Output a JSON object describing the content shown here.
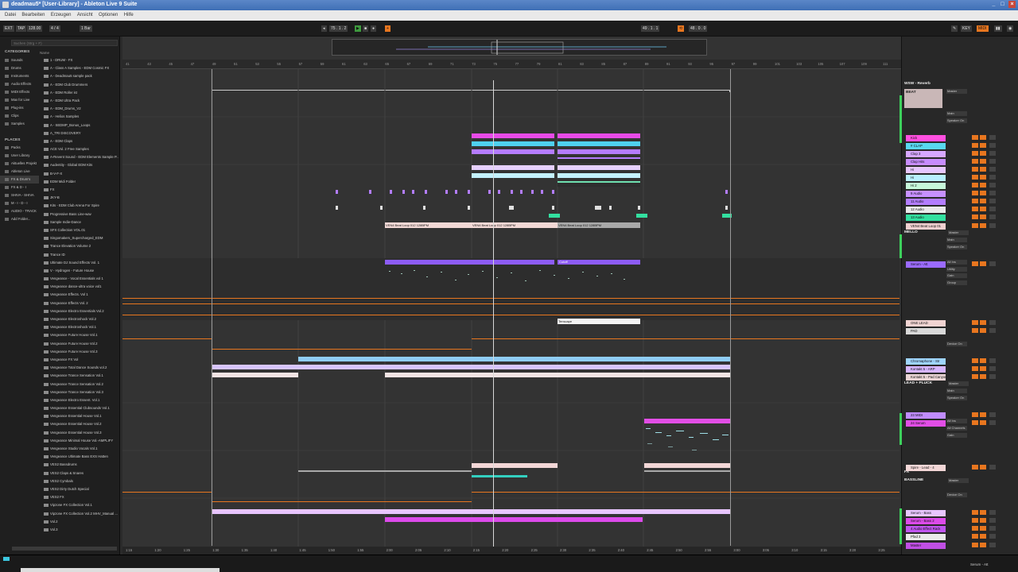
{
  "window": {
    "title": "deadmau5* [User-Library] - Ableton Live 9 Suite"
  },
  "menu": [
    "Datei",
    "Bearbeiten",
    "Erzeugen",
    "Ansicht",
    "Optionen",
    "Hilfe"
  ],
  "control_bar": {
    "ext": "EXT",
    "tap": "TAP",
    "tempo": "128.00",
    "signature": "4 / 4",
    "quantize": "1 Bar",
    "position": "75 . 1 . 2",
    "loop_start": "49 . 1 . 1",
    "loop_length": "48 . 0 . 0",
    "key": "KEY",
    "midi": "MIDI",
    "colors": {
      "accent": "#e8761f",
      "play": "#3e9a3e"
    }
  },
  "browser": {
    "search_placeholder": "Suchen (Strg + F)",
    "categories_header": "CATEGORIES",
    "name_header": "Name",
    "categories": [
      "Sounds",
      "Drums",
      "Instruments",
      "Audio Effects",
      "MIDI Effects",
      "Max for Live",
      "Plug-ins",
      "Clips",
      "Samples"
    ],
    "places_header": "PLACES",
    "places": [
      "Packs",
      "User Library",
      "Aktuelles Projekt",
      "Ableton Live",
      "FX & Drum's",
      "FX & D - I",
      "SHIVA - SHIVA",
      "M - I - D - I",
      "AUDIO - TRACK",
      "Add Folder..."
    ],
    "files": [
      "1 - DRUM - FX",
      "A - Class A Samples - EDM Cosmic FX",
      "A - Deadmau5 sample pack",
      "A - EDM Club Drummers",
      "A - EDM Roller ist",
      "A - EDM Ultra Pack",
      "A - EDM_Drums_V2",
      "A - Helios Samples",
      "A - SEDMP_Bonus_Loops",
      "A_TRI DISCOVERY",
      "A - EDM Claps",
      "ACE Vol. 2 Free Samples",
      "A-Revent Sound - EDM Elements Sample P...",
      "Audentity - Global EDM Kits",
      "B-V-F-X",
      "EDM Midi Folder",
      "FX",
      "JKY-B",
      "Kits - EDM Club Arena For Spire",
      "Progressive Bass Line-wav",
      "Sample Indie-Dance",
      "SFX Collection VOL.01",
      "Singomakers_Supercharged_EDM",
      "Trance Elevation Volume 2",
      "Trance ID",
      "Ultimate DJ Sound Effects Vol. 1",
      "V - Hydrogen - Future House",
      "Vengeance - Vocal Essentials vol 1",
      "Vengeance dance-ultra voice vol1",
      "Vengeance Effects. Vol 1",
      "Vengeance Effects Vol. 2",
      "Vengeance Electro Essentials Vol.2",
      "Vengeance Electroshock Vol.2",
      "Vengeance Electroshock Vol.1",
      "Vengeance Future House Vol.1",
      "Vengeance Future House Vol.2",
      "Vengeance Future House Vol.3",
      "Vengeance FX Vol",
      "Vengeance Total Dance Sounds vol.2",
      "Vengeance Trance Sensation Vol.1",
      "Vengeance Trance Sensation Vol.2",
      "Vengeance Trance Sensation Vol.3",
      "Vengeance Electro Essent. Vol.1",
      "Vengeance Essential Clubsounds Vol.1",
      "Vengeance Essential House Vol.1",
      "Vengeance Essential House Vol.2",
      "Vengeance Essential House Vol.3",
      "Vengeance Minimal House Vol.-AMPLIFY",
      "Vengeance Studio Vocals Vol.1",
      "Vengeance Ultimate Bass EXS Hatten",
      "VES2 Bassdrums",
      "VES2 Claps & Snares",
      "VES2 Cymbals",
      "VES2 Dirty Dutch Special",
      "VES2 FX",
      "Vipzone FX Collection Vol.1",
      "Vipzone FX Collection Vol.2 MHV_Manual ...",
      "Vol.2",
      "Vol.3"
    ]
  },
  "arrangement": {
    "ruler": [
      "41",
      "43",
      "45",
      "47",
      "49",
      "51",
      "53",
      "55",
      "57",
      "59",
      "61",
      "63",
      "65",
      "67",
      "69",
      "71",
      "73",
      "75",
      "77",
      "79",
      "81",
      "83",
      "85",
      "87",
      "89",
      "91",
      "93",
      "95",
      "97",
      "99",
      "101",
      "103",
      "105",
      "107",
      "109",
      "111"
    ],
    "time_axis": [
      "1:15",
      "1:20",
      "1:25",
      "1:30",
      "1:35",
      "1:40",
      "1:45",
      "1:50",
      "1:55",
      "2:00",
      "2:05",
      "2:10",
      "2:15",
      "2:20",
      "2:25",
      "2:30",
      "2:35",
      "2:40",
      "2:45",
      "2:50",
      "2:55",
      "3:00",
      "3:05",
      "3:10",
      "3:15",
      "3:20",
      "3:25"
    ],
    "clip_labels": {
      "vengeance_loop": "VEN4 Beat Loop 012 128BPM",
      "cutoff": "Cutoff",
      "tenscape": "Tenscape"
    }
  },
  "mixer": {
    "groups": [
      "WSW - Reverb",
      "BEAT",
      "MELLO",
      "LEAD + PLUCK",
      "FX",
      "BASSLINE"
    ],
    "master": "Master",
    "labels": {
      "main": "Main",
      "speaker_on": "Speaker On",
      "all_ins": "All Ins",
      "all_channels": "All Channels",
      "utility": "Utility",
      "gain": "Gain",
      "group": "Group",
      "device_on": "Device On"
    },
    "tracks": [
      {
        "name": "Kick",
        "color": "#ff4fe0"
      },
      {
        "name": "# CLAP",
        "color": "#58d8f0"
      },
      {
        "name": "Clap 3",
        "color": "#d7a7ff"
      },
      {
        "name": "Clap Hits",
        "color": "#c78cff"
      },
      {
        "name": "Hi",
        "color": "#e6c7ff"
      },
      {
        "name": "Hi",
        "color": "#b8f0ff"
      },
      {
        "name": "Hi 2",
        "color": "#c6f7d9"
      },
      {
        "name": "9 Audio",
        "color": "#c790ff"
      },
      {
        "name": "11 Audio",
        "color": "#b37dff"
      },
      {
        "name": "12 Audio",
        "color": "#eaeaea"
      },
      {
        "name": "13 Audio",
        "color": "#33e0a0"
      },
      {
        "name": "VEN4 Beat Loop 01",
        "color": "#f0d0d0"
      },
      {
        "name": "Serum - Att",
        "color": "#9b6bff"
      },
      {
        "name": "ONE LEAD",
        "color": "#f1d4d2"
      },
      {
        "name": "PAD",
        "color": "#d9d9d9"
      },
      {
        "name": "Chromaphone - Str",
        "color": "#9fd5ff"
      },
      {
        "name": "Kontakt 5 - ARP",
        "color": "#d7b5ff"
      },
      {
        "name": "Kontakt 5 - Pad Canyon",
        "color": "#e9d4d4"
      },
      {
        "name": "23 MIDI",
        "color": "#c08cff"
      },
      {
        "name": "24 Serum",
        "color": "#e24ee6"
      },
      {
        "name": "Spire - Lead - 4",
        "color": "#f3d7d7"
      },
      {
        "name": "Serum - Bass",
        "color": "#e8c6ff"
      },
      {
        "name": "Serum - Bass 2",
        "color": "#dc4bea"
      },
      {
        "name": "4 Audio Effect Rack",
        "color": "#c055f0"
      },
      {
        "name": "Pfad 3",
        "color": "#e9e9e9"
      },
      {
        "name": "Master",
        "color": "#c04fe4"
      }
    ]
  },
  "status": {
    "right": "Serum - Att"
  }
}
